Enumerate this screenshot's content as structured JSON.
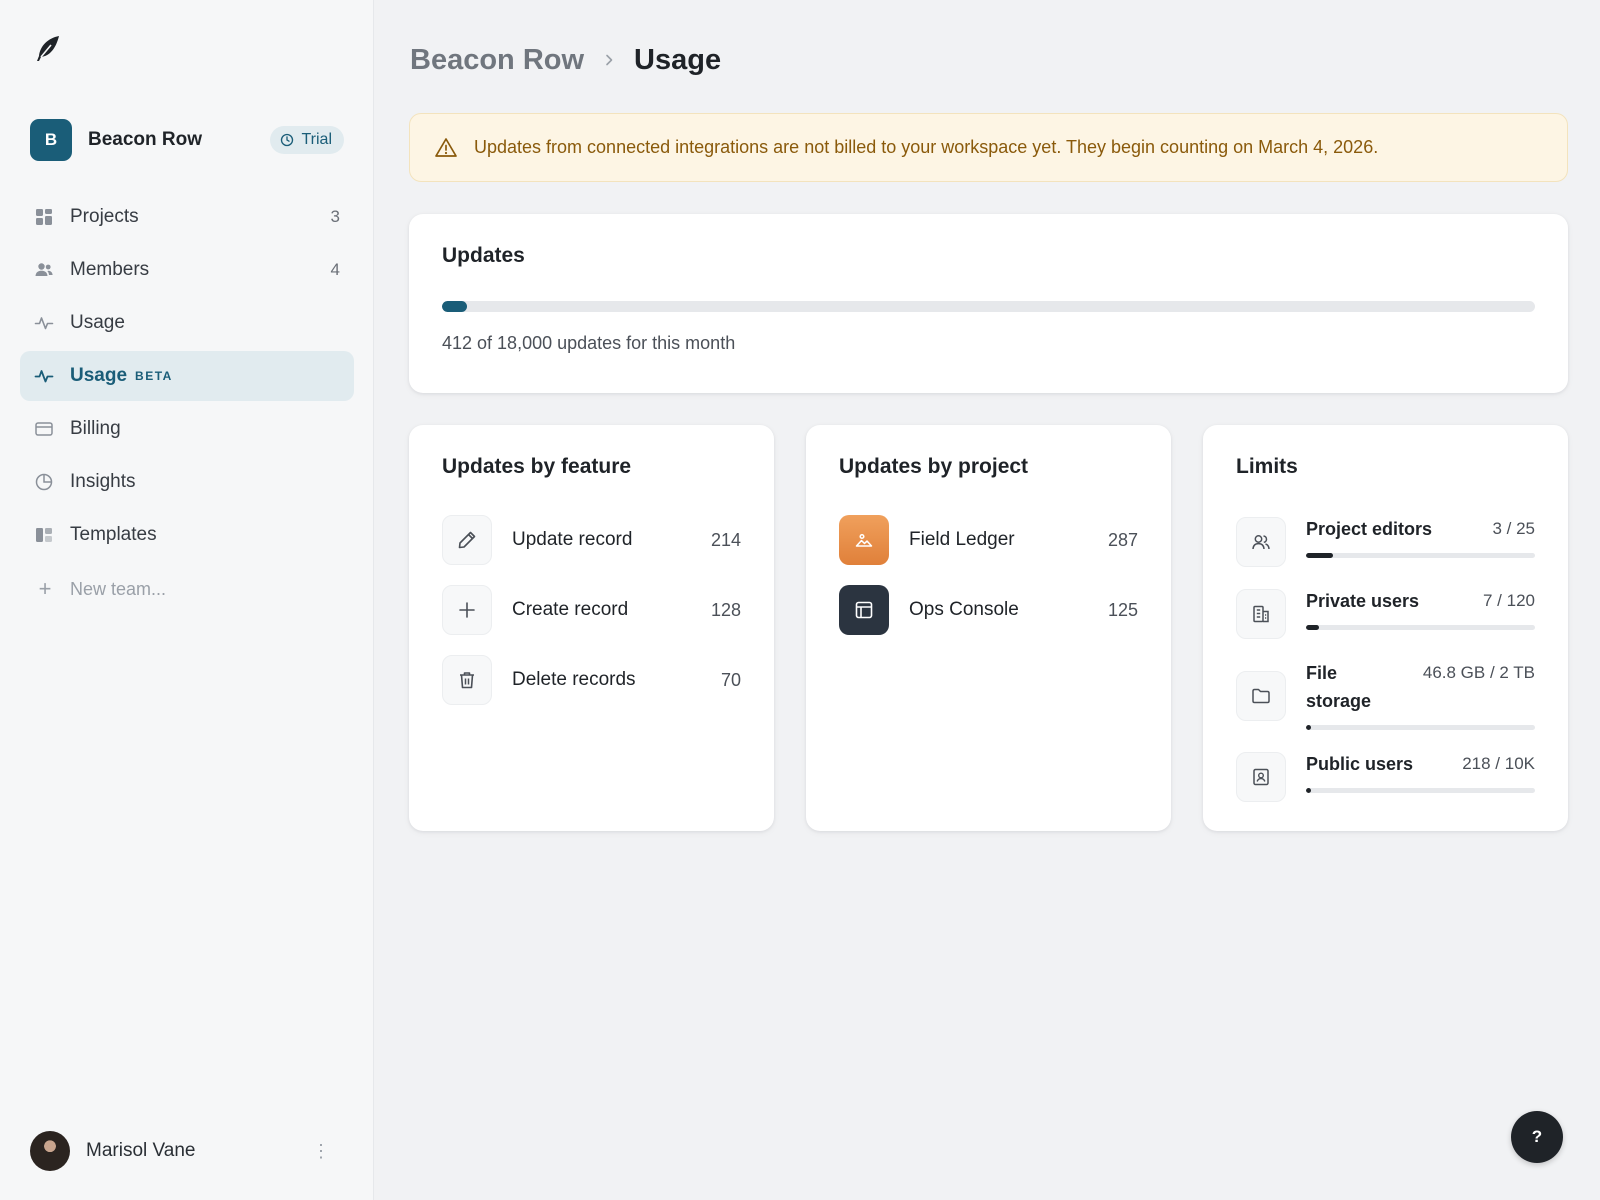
{
  "sidebar": {
    "logo_icon": "feather-icon",
    "team": {
      "initial": "B",
      "name": "Beacon Row",
      "badge": "Trial"
    },
    "items": [
      {
        "label": "Projects",
        "count": "3",
        "icon": "grid-icon"
      },
      {
        "label": "Members",
        "count": "4",
        "icon": "users-icon"
      },
      {
        "label": "Usage",
        "count": "",
        "icon": "activity-icon"
      },
      {
        "label": "Usage",
        "tag": "BETA",
        "count": "",
        "icon": "activity-icon",
        "active": true
      },
      {
        "label": "Billing",
        "count": "",
        "icon": "card-icon"
      },
      {
        "label": "Insights",
        "count": "",
        "icon": "pie-icon"
      },
      {
        "label": "Templates",
        "count": "",
        "icon": "template-icon"
      }
    ],
    "new_team": "New team...",
    "user": {
      "name": "Marisol Vane"
    }
  },
  "header": {
    "parent": "Beacon Row",
    "current": "Usage"
  },
  "alert": {
    "text": "Updates from connected integrations are not billed to your workspace yet. They begin counting on March 4, 2026.",
    "color": "#8a5a0b"
  },
  "updates": {
    "title": "Updates",
    "used": 412,
    "limit": 18000,
    "fill_fraction": 0.0229,
    "summary": "412 of 18,000 updates for this month"
  },
  "by_feature": {
    "title": "Updates by feature",
    "rows": [
      {
        "label": "Update record",
        "value": "214",
        "icon": "pencil-icon"
      },
      {
        "label": "Create record",
        "value": "128",
        "icon": "plus-icon"
      },
      {
        "label": "Delete records",
        "value": "70",
        "icon": "trash-icon"
      }
    ]
  },
  "by_project": {
    "title": "Updates by project",
    "rows": [
      {
        "label": "Field Ledger",
        "value": "287",
        "icon": "image-icon"
      },
      {
        "label": "Ops Console",
        "value": "125",
        "icon": "layout-icon"
      }
    ]
  },
  "limits": {
    "title": "Limits",
    "rows": [
      {
        "label": "Project editors",
        "value": "3 / 25",
        "fraction": 0.12,
        "icon": "users-icon"
      },
      {
        "label": "Private users",
        "value": "7 / 120",
        "fraction": 0.058,
        "icon": "building-icon"
      },
      {
        "label": "File storage",
        "value": "46.8 GB / 2 TB",
        "fraction": 0.023,
        "icon": "folder-icon"
      },
      {
        "label": "Public users",
        "value": "218 / 10K",
        "fraction": 0.022,
        "icon": "contact-icon"
      }
    ]
  },
  "help": {
    "label": "?"
  },
  "colors": {
    "accent": "#1a5d78",
    "alert_bg": "#fdf5e4"
  }
}
